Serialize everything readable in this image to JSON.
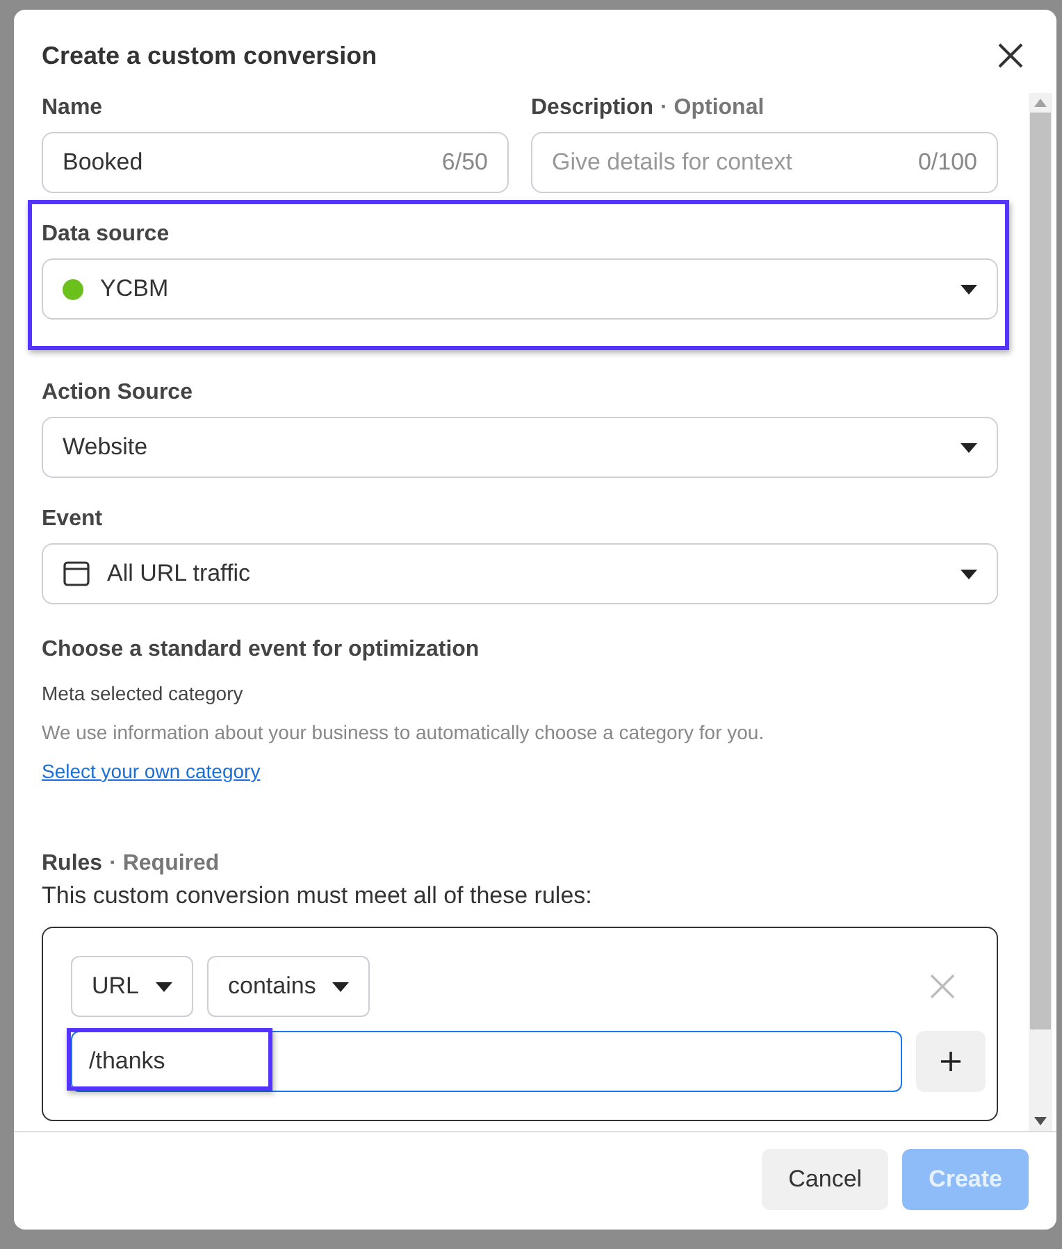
{
  "dialog": {
    "title": "Create a custom conversion"
  },
  "name_field": {
    "label": "Name",
    "value": "Booked",
    "counter": "6/50"
  },
  "description_field": {
    "label": "Description",
    "hint": "· Optional",
    "placeholder": "Give details for context",
    "counter": "0/100"
  },
  "data_source": {
    "label": "Data source",
    "value": "YCBM",
    "color": "#6cc01b",
    "highlighted": true
  },
  "action_source": {
    "label": "Action Source",
    "value": "Website"
  },
  "event": {
    "label": "Event",
    "value": "All URL traffic"
  },
  "optimization": {
    "heading": "Choose a standard event for optimization",
    "subheading": "Meta selected category",
    "description": "We use information about your business to automatically choose a category for you.",
    "link": "Select your own category"
  },
  "rules": {
    "label": "Rules",
    "hint": "· Required",
    "description": "This custom conversion must meet all of these rules:",
    "conditions": [
      {
        "field": "URL",
        "operator": "contains",
        "value": "/thanks",
        "highlighted": true
      }
    ]
  },
  "buttons": [
    {
      "label": "Cancel",
      "kind": "secondary",
      "disabled": false
    },
    {
      "label": "Create",
      "kind": "primary",
      "disabled": true
    }
  ]
}
